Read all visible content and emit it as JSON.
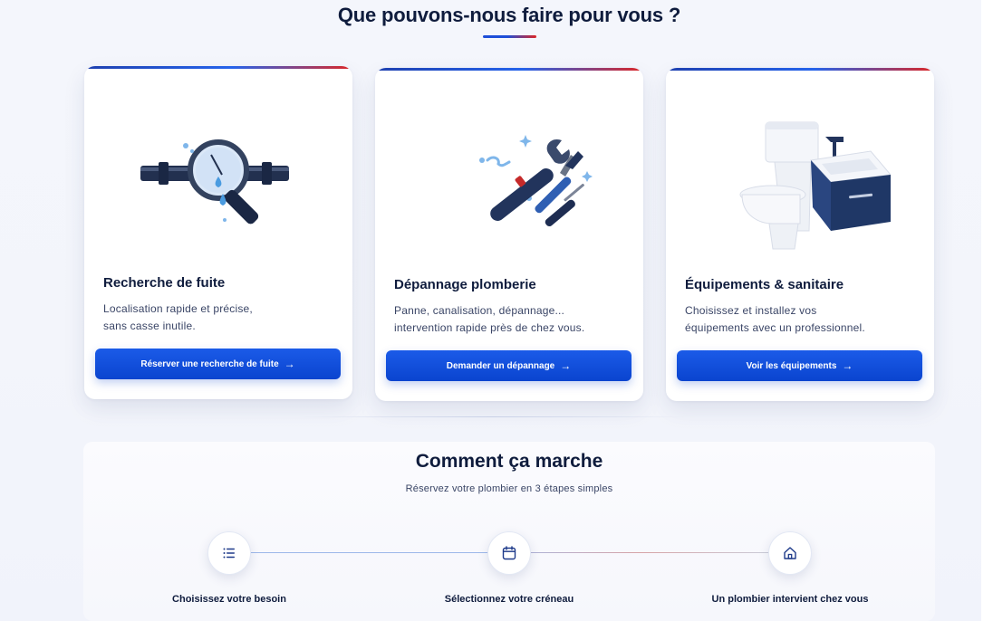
{
  "services": {
    "title": "Que pouvons-nous faire pour vous ?",
    "cards": [
      {
        "title": "Recherche de fuite",
        "description_line1": "Localisation rapide et précise,",
        "description_line2": "sans casse inutile.",
        "button_label": "Réserver une recherche de fuite",
        "illustration": "leak-detection-magnifier-icon"
      },
      {
        "title": "Dépannage plomberie",
        "description_line1": "Panne, canalisation, dépannage...",
        "description_line2": "intervention rapide près de chez vous.",
        "button_label": "Demander un dépannage",
        "illustration": "wrench-screwdriver-icon"
      },
      {
        "title": "Équipements & sanitaire",
        "description_line1": "Choisissez et installez vos",
        "description_line2": "équipements avec un professionnel.",
        "button_label": "Voir les équipements",
        "illustration": "toilet-sink-icon"
      }
    ],
    "button_arrow": "→"
  },
  "how_it_works": {
    "title": "Comment ça marche",
    "subtitle": "Réservez votre plombier en 3 étapes simples",
    "steps": [
      {
        "label": "Choisissez votre besoin",
        "icon": "list-icon"
      },
      {
        "label": "Sélectionnez votre créneau",
        "icon": "calendar-icon"
      },
      {
        "label": "Un plombier intervient chez vous",
        "icon": "home-icon"
      }
    ]
  },
  "colors": {
    "primary": "#0a44cf",
    "accent_red": "#dc2626",
    "navy": "#0f1c3d"
  }
}
